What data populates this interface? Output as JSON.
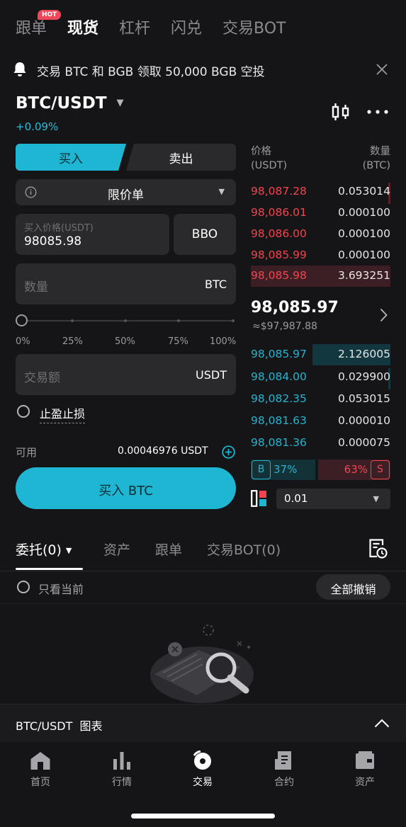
{
  "top_tabs": [
    "跟单",
    "现货",
    "杠杆",
    "闪兑",
    "交易BOT"
  ],
  "hot_badge": "HOT",
  "notice": "交易 BTC 和 BGB 领取 50,000 BGB 空投",
  "pair": {
    "name": "BTC/USDT",
    "change": "+0.09%"
  },
  "trade": {
    "buy": "买入",
    "sell": "卖出",
    "order_type": "限价单",
    "price_label": "买入价格(USDT)",
    "price_value": "98085.98",
    "bbo": "BBO",
    "qty_placeholder": "数量",
    "qty_unit": "BTC",
    "pcts": [
      "0%",
      "25%",
      "50%",
      "75%",
      "100%"
    ],
    "amount_placeholder": "交易额",
    "amount_unit": "USDT",
    "tpsl": "止盈止损",
    "available_label": "可用",
    "available_value": "0.00046976 USDT",
    "submit": "买入 BTC"
  },
  "orderbook": {
    "price_header": [
      "价格",
      "(USDT)"
    ],
    "qty_header": [
      "数量",
      "(BTC)"
    ],
    "asks": [
      {
        "price": "98,087.28",
        "qty": "0.053014"
      },
      {
        "price": "98,086.01",
        "qty": "0.000100"
      },
      {
        "price": "98,086.00",
        "qty": "0.000100"
      },
      {
        "price": "98,085.99",
        "qty": "0.000100"
      },
      {
        "price": "98,085.98",
        "qty": "3.693251"
      }
    ],
    "last_price": "98,085.97",
    "last_usd": "≈$97,987.88",
    "bids": [
      {
        "price": "98,085.97",
        "qty": "2.126005"
      },
      {
        "price": "98,084.00",
        "qty": "0.029900"
      },
      {
        "price": "98,082.35",
        "qty": "0.053015"
      },
      {
        "price": "98,081.63",
        "qty": "0.000010"
      },
      {
        "price": "98,081.36",
        "qty": "0.000075"
      }
    ],
    "buy_badge": "B",
    "buy_pct": "37%",
    "sell_pct": "63%",
    "sell_badge": "S",
    "depth": "0.01"
  },
  "orders": {
    "tabs": [
      "委托(0)",
      "资产",
      "跟单",
      "交易BOT(0)"
    ],
    "only_current": "只看当前",
    "cancel_all": "全部撤销"
  },
  "chart_bar": "BTC/USDT  图表",
  "nav": [
    "首页",
    "行情",
    "交易",
    "合约",
    "资产"
  ],
  "colors": {
    "accent": "#1fb6d3",
    "sell": "#f0454f",
    "background": "#151517"
  }
}
